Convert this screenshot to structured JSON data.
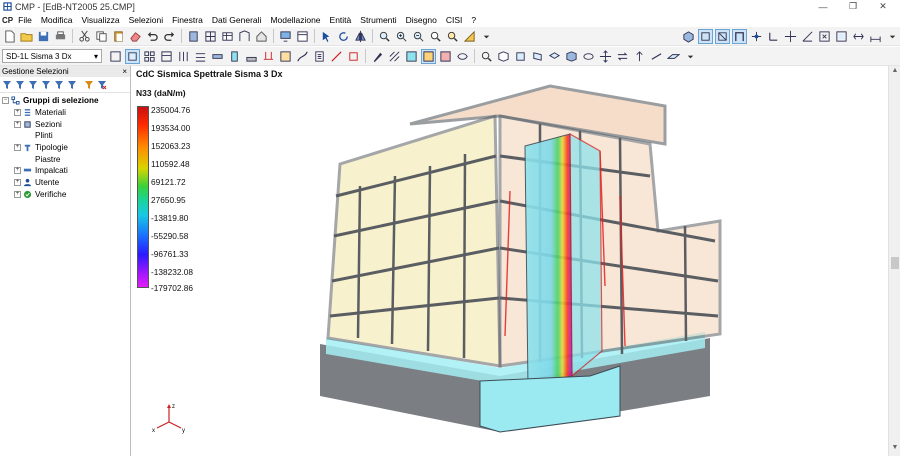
{
  "window": {
    "title": "CMP - [EdB-NT2005 25.CMP]",
    "controls": [
      "—",
      "❐",
      "✕"
    ]
  },
  "menu": {
    "logo": "CP",
    "items": [
      "File",
      "Modifica",
      "Visualizza",
      "Selezioni",
      "Finestra",
      "Dati Generali",
      "Modellazione",
      "Entità",
      "Strumenti",
      "Disegno",
      "CISI",
      "?"
    ]
  },
  "toolbar": {
    "load_case_select": "SD-1L Sisma 3 Dx"
  },
  "panel": {
    "title": "Gestione Selezioni",
    "close": "×",
    "root": "Gruppi di selezione",
    "items": [
      {
        "label": "Materiali",
        "icon": "materials-icon"
      },
      {
        "label": "Sezioni",
        "icon": "sections-icon"
      },
      {
        "label": "Plinti",
        "icon": "footings-icon"
      },
      {
        "label": "Tipologie",
        "icon": "typologies-icon"
      },
      {
        "label": "Piastre",
        "icon": "plates-icon"
      },
      {
        "label": "Impalcati",
        "icon": "floors-icon"
      },
      {
        "label": "Utente",
        "icon": "user-icon"
      },
      {
        "label": "Verifiche",
        "icon": "checks-icon"
      }
    ]
  },
  "viewport": {
    "title": "CdC Sismica Spettrale Sisma 3 Dx",
    "units": "N33 (daN/m)",
    "legend": [
      "235004.76",
      "193534.00",
      "152063.23",
      "110592.48",
      "69121.72",
      "27650.95",
      "-13819.80",
      "-55290.58",
      "-96761.33",
      "-138232.08",
      "-179702.86"
    ],
    "axis_labels": {
      "x": "x",
      "y": "y",
      "z": "z"
    }
  },
  "colors": {
    "accent": "#6aa3d5",
    "beam": "#666a6e",
    "wall": "#8fe3ec",
    "stress_high": "#e41e1e",
    "stress_low": "#9e16ff"
  }
}
